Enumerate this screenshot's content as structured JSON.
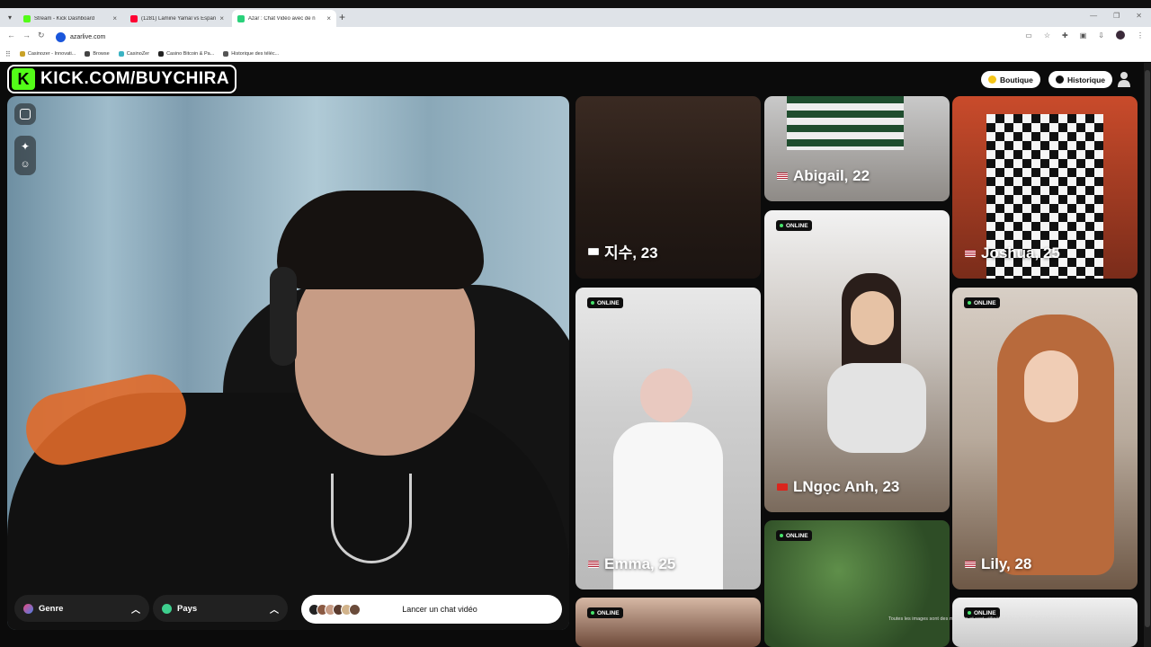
{
  "browser": {
    "tabs": [
      {
        "title": "Stream - Kick Dashboard",
        "color": "#53fc18",
        "active": false
      },
      {
        "title": "(1281) Lamine Yamal vs Espanyol",
        "color": "#ff0033",
        "active": false
      },
      {
        "title": "Azar : Chat Vidéo avec de n",
        "color": "#2ad17a",
        "active": true
      }
    ],
    "url": "azarlive.com",
    "bookmarks": [
      "Casinozer - Innovati...",
      "Browse",
      "CasinoZer",
      "Casino Bitcoin & Pa...",
      "Historique des téléc..."
    ]
  },
  "header": {
    "logo_text": "KICK.COM/BUYCHIRA",
    "logo_k": "K",
    "shop_label": "Boutique",
    "history_label": "Historique"
  },
  "controls": {
    "gender_label": "Genre",
    "country_label": "Pays",
    "start_label": "Lancer un chat vidéo"
  },
  "cards": [
    {
      "name": "지수, 23",
      "online": false
    },
    {
      "name": "Abigail, 22",
      "online": false
    },
    {
      "name": "Joshua, 25",
      "online": false
    },
    {
      "name": "Emma, 25",
      "online": true
    },
    {
      "name": "LNgọc Anh, 23",
      "online": true
    },
    {
      "name": "Lily, 28",
      "online": true
    },
    {
      "name": "",
      "online": true
    },
    {
      "name": "",
      "online": true
    },
    {
      "name": "",
      "online": true
    }
  ],
  "online_label": "ONLINE",
  "disclaimer": "Toutes les images sont des modèles et sont utilisées à des fins d'illustration uniquement",
  "colors": {
    "kick_green": "#53fc18",
    "online_dot": "#46e36b"
  }
}
